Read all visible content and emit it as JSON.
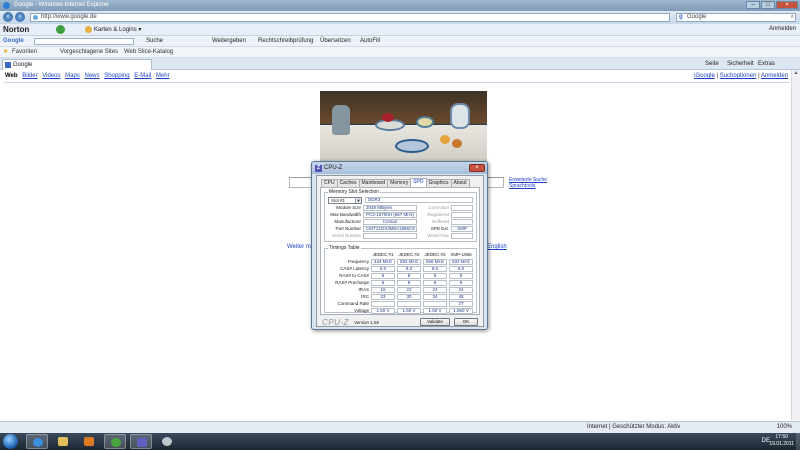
{
  "window": {
    "title": "Google - Windows Internet Explorer",
    "address": "http://www.google.de",
    "search_engine": "Google",
    "minimize": "–",
    "maximize": "□",
    "close": "×"
  },
  "norton": {
    "brand": "Norton",
    "karten_label": "Karten & Logins",
    "anmelden": "Anmelden"
  },
  "google_toolbar": {
    "label": "Google",
    "items": [
      "Suche",
      "Weitergeben",
      "Rechtschreibprüfung",
      "Übersetzen",
      "AutoFill"
    ]
  },
  "favorites": {
    "label": "Favoriten",
    "items": [
      "Vorgeschlagene Sites",
      "Web Slice-Katalog"
    ]
  },
  "tab": {
    "label": "Google"
  },
  "commandbar": [
    "Seite",
    "Sicherheit",
    "Extras"
  ],
  "google": {
    "nav": [
      "Web",
      "Bilder",
      "Videos",
      "Maps",
      "News",
      "Shopping",
      "E-Mail",
      "Mehr"
    ],
    "right_links": [
      "iGoogle",
      "Suchoptionen",
      "Anmelden"
    ],
    "options": [
      "Erweiterte Suche",
      "Sprachtools"
    ],
    "weiter_text": "Weiter m",
    "english": "English"
  },
  "cpuz": {
    "title": "CPU-Z",
    "logo": "Z",
    "close": "×",
    "tabs": [
      "CPU",
      "Caches",
      "Mainboard",
      "Memory",
      "SPD",
      "Graphics",
      "About"
    ],
    "active_tab": "SPD",
    "slot_group_title": "Memory Slot Selection",
    "slot": "Slot #1",
    "memory_type": "DDR3",
    "slot_fields": [
      {
        "label": "Module Size",
        "value": "2048 MBytes"
      },
      {
        "label": "Max Bandwidth",
        "value": "PC3-10700H (667 MHz)"
      },
      {
        "label": "Manufacturer",
        "value": "Corsair"
      },
      {
        "label": "Part Number",
        "value": "CMT12GX3M6A1886C9"
      },
      {
        "label": "Serial Number",
        "value": ""
      }
    ],
    "slot_right_fields": [
      {
        "label": "Correction",
        "value": ""
      },
      {
        "label": "Registered",
        "value": ""
      },
      {
        "label": "Buffered",
        "value": ""
      },
      {
        "label": "SPD Ext.",
        "value": "XMP"
      },
      {
        "label": "Week/Year",
        "value": ""
      }
    ],
    "timings_title": "Timings Table",
    "timing_columns": [
      "JEDEC #1",
      "JEDEC #2",
      "JEDEC #3",
      "XMP-1866"
    ],
    "timing_rows": [
      {
        "label": "Frequency",
        "values": [
          "444 MHz",
          "592 MHz",
          "666 MHz",
          "933 MHz"
        ]
      },
      {
        "label": "CAS# Latency",
        "values": [
          "6.0",
          "8.0",
          "9.0",
          "9.0"
        ]
      },
      {
        "label": "RAS# to CAS#",
        "values": [
          "6",
          "8",
          "9",
          "9"
        ]
      },
      {
        "label": "RAS# Precharge",
        "values": [
          "6",
          "8",
          "9",
          "9"
        ]
      },
      {
        "label": "tRAS",
        "values": [
          "16",
          "22",
          "24",
          "24"
        ]
      },
      {
        "label": "tRC",
        "values": [
          "23",
          "30",
          "34",
          "48"
        ]
      },
      {
        "label": "Command Rate",
        "values": [
          "",
          "",
          "",
          "2T"
        ]
      },
      {
        "label": "Voltage",
        "values": [
          "1.50 V",
          "1.50 V",
          "1.50 V",
          "1.650 V"
        ]
      }
    ],
    "footer_brand": "CPU-Z",
    "version": "Version 1.56",
    "validate_button": "Validate",
    "ok_button": "OK"
  },
  "statusbar": {
    "security": "Internet | Geschützter Modus: Aktiv",
    "zoom": "100%"
  },
  "taskbar": {
    "language": "DE",
    "time": "17:50",
    "date": "19.01.2011"
  }
}
